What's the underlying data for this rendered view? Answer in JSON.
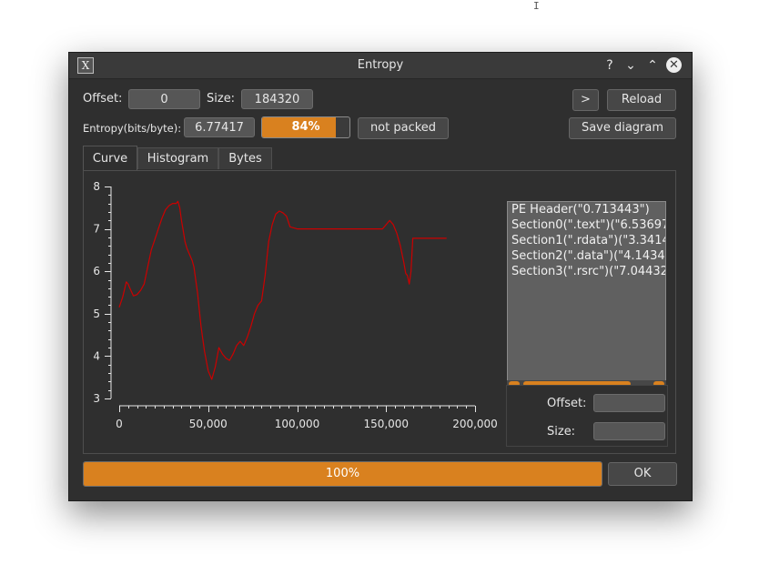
{
  "window": {
    "title": "Entropy",
    "app_icon": "X",
    "buttons": {
      "help": "?",
      "minimize": "⌄",
      "maximize": "⌃",
      "close": "✕"
    }
  },
  "toolbar": {
    "offset_label": "Offset:",
    "offset_value": "0",
    "size_label": "Size:",
    "size_value": "184320",
    "next_label": ">",
    "reload_label": "Reload",
    "entropy_label": "Entropy(bits/byte):",
    "entropy_value": "6.77417",
    "entropy_percent_text": "84%",
    "entropy_percent": 84,
    "packed_status": "not packed",
    "save_label": "Save diagram"
  },
  "tabs": [
    {
      "label": "Curve",
      "active": true
    },
    {
      "label": "Histogram",
      "active": false
    },
    {
      "label": "Bytes",
      "active": false
    }
  ],
  "chart_data": {
    "type": "line",
    "title": "",
    "xlabel": "",
    "ylabel": "",
    "xlim": [
      0,
      200000
    ],
    "ylim": [
      3,
      8
    ],
    "x_ticks": [
      0,
      50000,
      100000,
      150000,
      200000
    ],
    "x_tick_labels": [
      "0",
      "50,000",
      "100,000",
      "150,000",
      "200,000"
    ],
    "y_ticks": [
      3,
      4,
      5,
      6,
      7,
      8
    ],
    "y_tick_labels": [
      "3",
      "4",
      "5",
      "6",
      "7",
      "8"
    ],
    "grid": false,
    "series": [
      {
        "color": "#cc0000",
        "x": [
          0,
          2000,
          4000,
          5000,
          6000,
          8000,
          10000,
          12000,
          14000,
          16000,
          18000,
          20000,
          22000,
          24000,
          26000,
          28000,
          30000,
          31000,
          32000,
          33000,
          34000,
          35000,
          36000,
          37000,
          38000,
          39000,
          40000,
          41000,
          42000,
          44000,
          46000,
          48000,
          50000,
          52000,
          54000,
          56000,
          58000,
          60000,
          62000,
          64000,
          66000,
          68000,
          70000,
          72000,
          74000,
          76000,
          78000,
          80000,
          82000,
          84000,
          86000,
          88000,
          90000,
          92000,
          94000,
          96000,
          100000,
          110000,
          120000,
          130000,
          140000,
          148000,
          150000,
          152000,
          154000,
          156000,
          158000,
          160000,
          161000,
          162000,
          163000,
          164000,
          165000,
          167000,
          170000,
          175000,
          180000,
          184000
        ],
        "y": [
          5.15,
          5.4,
          5.75,
          5.7,
          5.6,
          5.42,
          5.45,
          5.55,
          5.7,
          6.1,
          6.5,
          6.75,
          7.0,
          7.25,
          7.45,
          7.55,
          7.6,
          7.6,
          7.6,
          7.65,
          7.5,
          7.2,
          6.95,
          6.7,
          6.55,
          6.45,
          6.35,
          6.25,
          6.1,
          5.5,
          4.7,
          4.1,
          3.65,
          3.45,
          3.75,
          4.2,
          4.05,
          3.95,
          3.9,
          4.05,
          4.25,
          4.35,
          4.25,
          4.45,
          4.7,
          5.0,
          5.2,
          5.3,
          5.9,
          6.7,
          7.1,
          7.35,
          7.42,
          7.38,
          7.3,
          7.05,
          7.0,
          7.0,
          7.0,
          7.0,
          7.0,
          7.0,
          7.1,
          7.2,
          7.1,
          6.9,
          6.6,
          6.2,
          5.95,
          5.9,
          5.7,
          6.0,
          6.78,
          6.78,
          6.78,
          6.78,
          6.78,
          6.78
        ]
      }
    ]
  },
  "sections": [
    "PE Header(\"0.713443\")",
    "Section0(\".text\")(\"6.53697",
    "Section1(\".rdata\")(\"3.3414",
    "Section2(\".data\")(\"4.1434",
    "Section3(\".rsrc\")(\"7.04432"
  ],
  "selection": {
    "offset_label": "Offset:",
    "offset_value": "",
    "size_label": "Size:",
    "size_value": ""
  },
  "progress": {
    "text": "100%",
    "percent": 100
  },
  "ok_label": "OK",
  "colors": {
    "accent": "#d9811f",
    "curve": "#cc0000",
    "window_bg": "#2f2f2f"
  }
}
